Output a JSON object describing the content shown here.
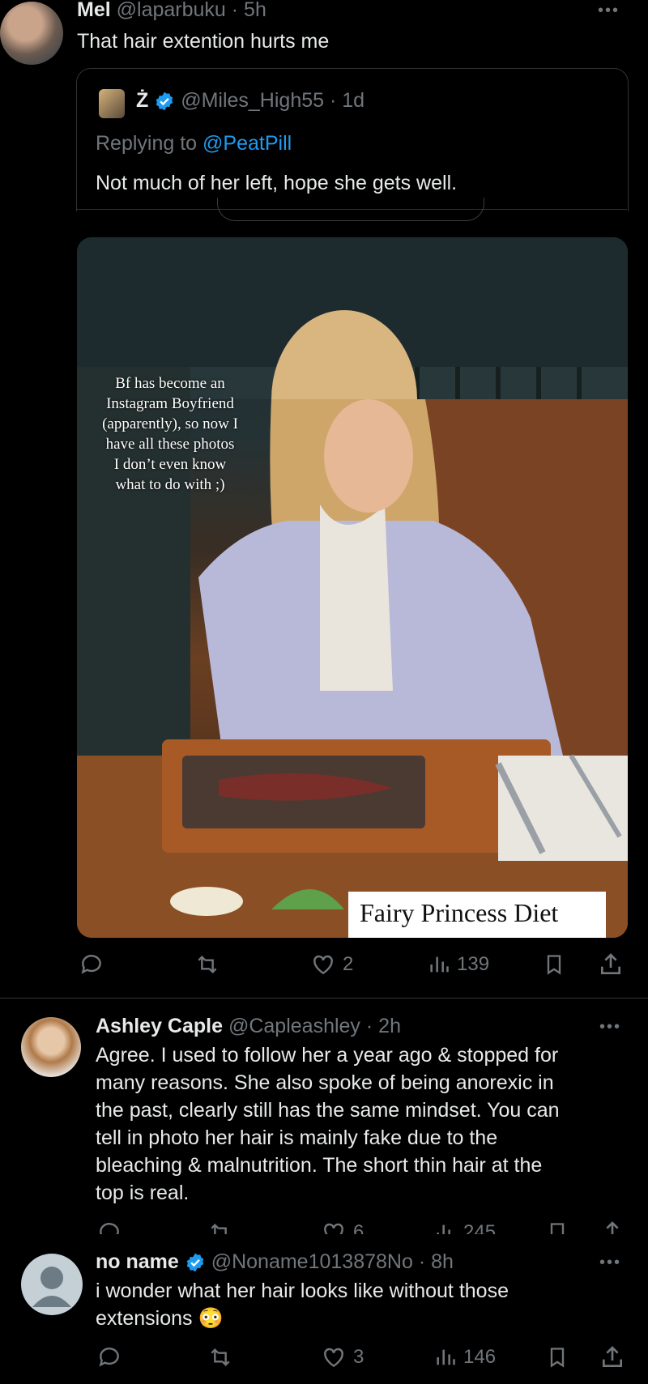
{
  "tweet1": {
    "name": "Mel",
    "handle": "@laparbuku",
    "time": "· 5h",
    "text": "That hair extention hurts me",
    "quote": {
      "name": "Ż",
      "handle": "@Miles_High55",
      "time": "· 1d",
      "replying_prefix": "Replying to",
      "replying_handle": "@PeatPill",
      "text": "Not much of her left, hope she gets well."
    },
    "image": {
      "overlay_text": [
        "Bf has become an",
        "Instagram Boyfriend",
        "(apparently), so now I",
        "have all these photos",
        "I don’t even know",
        "what to do with ;)"
      ],
      "caption": "Fairy Princess Diet"
    },
    "actions": {
      "likes": "2",
      "views": "139"
    }
  },
  "reply1": {
    "name": "Ashley Caple",
    "handle": "@Capleashley",
    "time": "· 2h",
    "text_lines": [
      "Agree. I used to follow her a year ago & stopped for",
      "many reasons. She also spoke of being anorexic in",
      "the past, clearly still has the same mindset. You can",
      "tell in photo her hair is mainly fake due to the",
      "bleaching & malnutrition. The short thin hair at the",
      "top is real."
    ],
    "actions": {
      "likes": "6",
      "views": "245"
    }
  },
  "reply2": {
    "name": "no name",
    "handle": "@Noname1013878No",
    "time": "· 8h",
    "text_lines": [
      "i wonder what her hair looks like without those",
      "extensions 😳"
    ],
    "actions": {
      "likes": "3",
      "views": "146"
    }
  },
  "colors": {
    "accent": "#1d9bf0",
    "muted": "#71767b",
    "text": "#e7e9ea",
    "divider": "#2f3336"
  }
}
